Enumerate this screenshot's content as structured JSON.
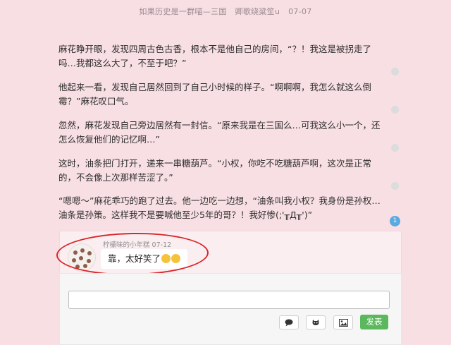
{
  "header": {
    "title": "如果历史是一群喵—三国",
    "author": "卿歌绕粱笙u",
    "date": "07-07"
  },
  "story": {
    "paragraphs": [
      "麻花睁开眼，发现四周古色古香，根本不是他自己的房间，“？！我这是被拐走了吗…我都这么大了，不至于吧？”",
      "他起来一看，发现自己居然回到了自己小时候的样子。“啊啊啊，我怎么就这么倒霉？”麻花叹口气。",
      "忽然，麻花发现自己旁边居然有一封信。“原来我是在三国么…可我这么小一个，还怎么恢复他们的记忆啊…”",
      "这时，油条把门打开，递来一串糖葫芦。“小权，你吃不吃糖葫芦啊，这次是正常的，不会像上次那样苦涩了。”",
      "“嗯嗯～”麻花乖巧的跑了过去。他一边吃一边想，“油条叫我小权？我身份是孙权…油条是孙策。这样我不是要喊他至少5年的哥？！我好惨(;'╥Д╥')”"
    ]
  },
  "comment_count": "1",
  "comment": {
    "author": "柠檬味的小年糕",
    "date": "07-12",
    "text": "靠，太好笑了"
  },
  "reply": {
    "send_label": "发表",
    "tools": [
      "comment-icon",
      "github-icon",
      "image-icon"
    ]
  },
  "colors": {
    "background": "#f8dfe4",
    "send_button": "#5cb85c",
    "badge": "#5aa9e0",
    "annotation_circle": "#d9262a"
  }
}
